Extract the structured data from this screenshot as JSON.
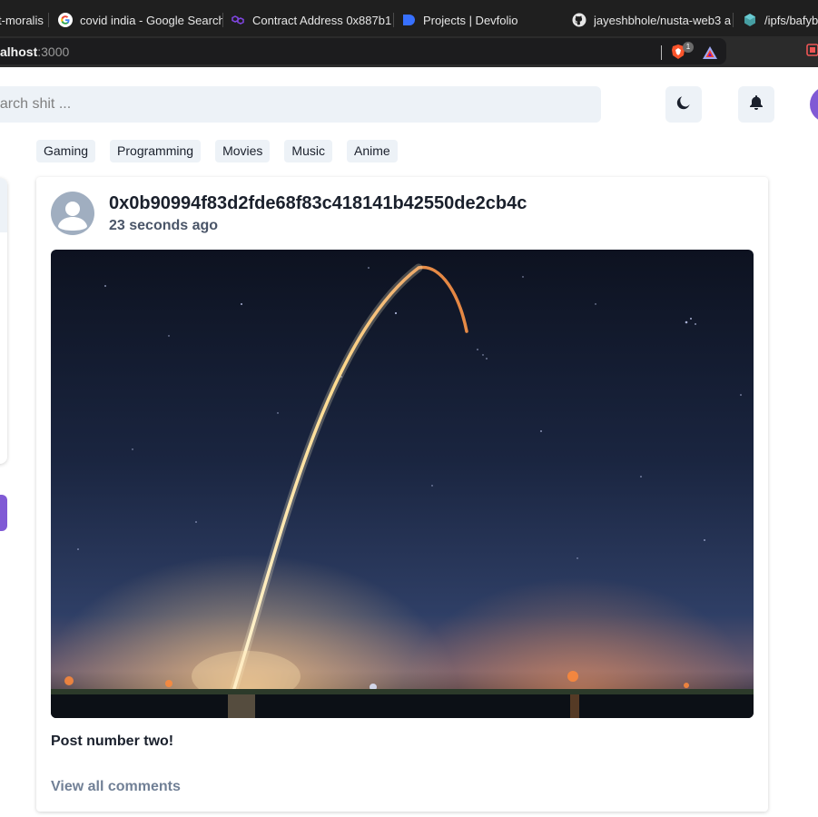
{
  "browser": {
    "tabs": [
      {
        "label": "t-moralis",
        "icon": "generic-favicon"
      },
      {
        "label": "covid india - Google Search",
        "icon": "google-icon"
      },
      {
        "label": "Contract Address 0x887b1",
        "icon": "polygon-icon"
      },
      {
        "label": "Projects | Devfolio",
        "icon": "devfolio-icon"
      },
      {
        "label": "jayeshbhole/nusta-web3 a",
        "icon": "github-icon"
      },
      {
        "label": "/ipfs/bafyb",
        "icon": "ipfs-icon"
      }
    ],
    "url_host": "alhost",
    "url_port": ":3000",
    "brave_badge": "1"
  },
  "header": {
    "search_placeholder": "earch shit ...",
    "theme_toggle_icon": "moon-icon",
    "notifications_icon": "bell-icon"
  },
  "tags": [
    "Gaming",
    "Programming",
    "Movies",
    "Music",
    "Anime"
  ],
  "post": {
    "author": "0x0b90994f83d2fde68f83c418141b42550de2cb4c",
    "time": "23 seconds ago",
    "image_description": "rocket-launch-night-sky",
    "caption": "Post number two!",
    "comments_link": "View all comments"
  },
  "colors": {
    "accent": "#805ad5",
    "chip_bg": "#edf2f7",
    "text_primary": "#1a202c",
    "text_muted": "#718096"
  }
}
